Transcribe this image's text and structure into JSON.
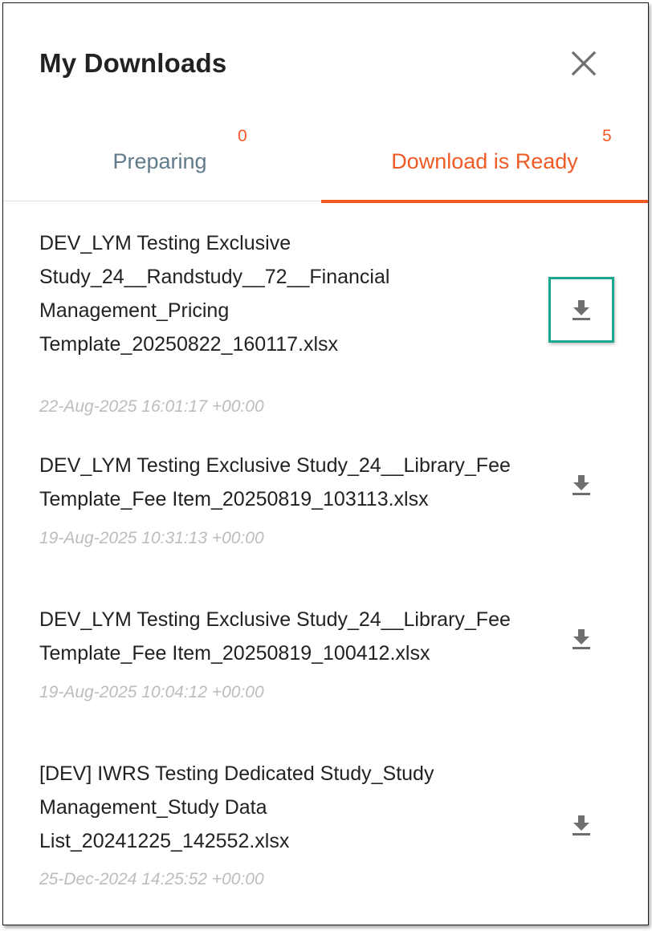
{
  "header": {
    "title": "My Downloads",
    "close_icon": "close-icon"
  },
  "tabs": [
    {
      "label": "Preparing",
      "count": "0",
      "active": false
    },
    {
      "label": "Download is Ready",
      "count": "5",
      "active": true
    }
  ],
  "colors": {
    "accent": "#f15a24",
    "inactive_tab": "#5f7a88",
    "focus_outline": "#1aa68f",
    "text": "#222222",
    "timestamp": "#bdbdbd",
    "icon": "#6f6f6f"
  },
  "downloads": [
    {
      "name": "DEV_LYM Testing Exclusive Study_24__Randstudy__72__Financial Management_Pricing Template_20250822_160117.xlsx",
      "date": "22-Aug-2025 16:01:17 +00:00",
      "icon": "download-icon"
    },
    {
      "name": "DEV_LYM Testing Exclusive Study_24__Library_Fee Template_Fee Item_20250819_103113.xlsx",
      "date": "19-Aug-2025 10:31:13 +00:00",
      "icon": "download-icon"
    },
    {
      "name": "DEV_LYM Testing Exclusive Study_24__Library_Fee Template_Fee Item_20250819_100412.xlsx",
      "date": "19-Aug-2025 10:04:12 +00:00",
      "icon": "download-icon"
    },
    {
      "name": "[DEV] IWRS Testing Dedicated Study_Study Management_Study Data List_20241225_142552.xlsx",
      "date": "25-Dec-2024 14:25:52 +00:00",
      "icon": "download-icon"
    }
  ]
}
